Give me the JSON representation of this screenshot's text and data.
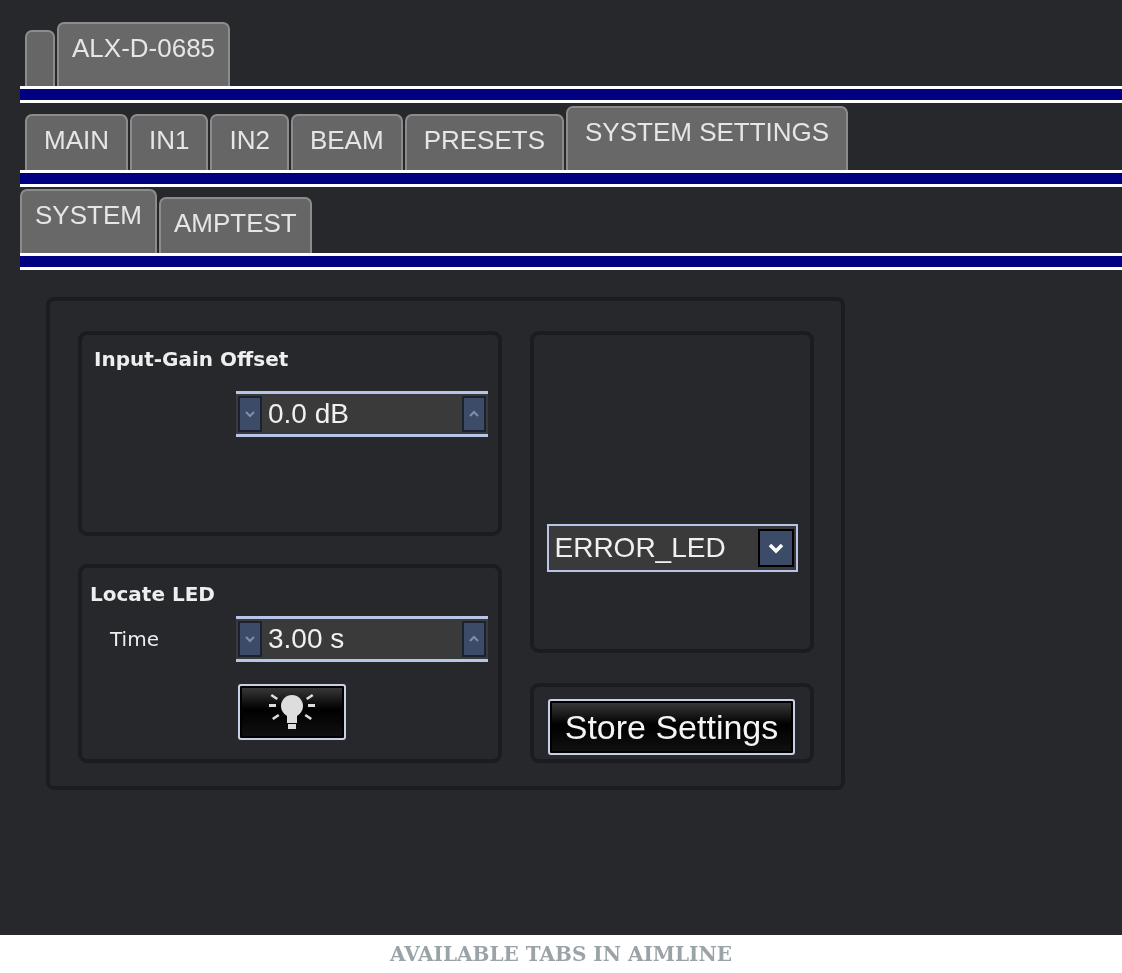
{
  "device_tabs": [
    {
      "selected": false
    },
    {
      "label": "ALX-D-0685",
      "selected": true
    }
  ],
  "main_tabs": [
    {
      "label": "MAIN",
      "selected": false
    },
    {
      "label": "IN1",
      "selected": false
    },
    {
      "label": "IN2",
      "selected": false
    },
    {
      "label": "BEAM",
      "selected": false
    },
    {
      "label": "PRESETS",
      "selected": false
    },
    {
      "label": "SYSTEM SETTINGS",
      "selected": true
    }
  ],
  "sub_tabs": [
    {
      "label": "SYSTEM",
      "selected": true
    },
    {
      "label": "AMPTEST",
      "selected": false
    }
  ],
  "input_gain": {
    "title": "Input-Gain Offset",
    "value": "0.0 dB"
  },
  "locate_led": {
    "title": "Locate LED",
    "time_label": "Time",
    "value": "3.00 s"
  },
  "led_select": {
    "value": "ERROR_LED"
  },
  "store_button": "Store Settings",
  "caption": "AVAILABLE TABS IN AIMLINE"
}
